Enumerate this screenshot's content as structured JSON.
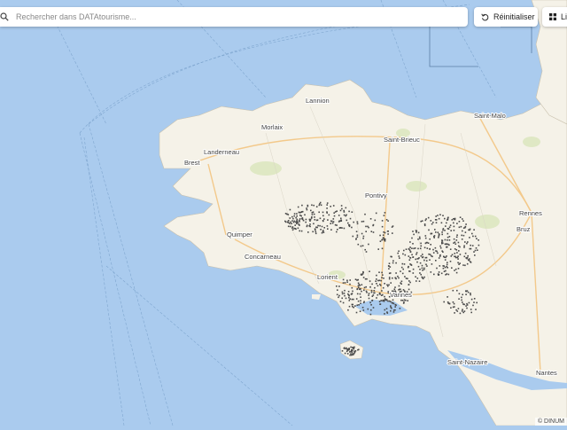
{
  "search": {
    "placeholder": "Rechercher dans DATAtourisme..."
  },
  "toolbar": {
    "reset_label": "Réinitialiser",
    "list_label": "Li"
  },
  "attribution": "© DINUM",
  "cities": [
    {
      "name": "Lannion"
    },
    {
      "name": "Morlaix"
    },
    {
      "name": "Saint-Malo"
    },
    {
      "name": "Saint-Brieuc"
    },
    {
      "name": "Landerneau"
    },
    {
      "name": "Brest"
    },
    {
      "name": "Rennes"
    },
    {
      "name": "Pontivy"
    },
    {
      "name": "Quimper"
    },
    {
      "name": "Bruz"
    },
    {
      "name": "Concarneau"
    },
    {
      "name": "Lorient"
    },
    {
      "name": "Vannes"
    },
    {
      "name": "Saint-Nazaire"
    },
    {
      "name": "Nantes"
    }
  ],
  "colors": {
    "sea": "#aacbee",
    "land": "#f5f2e8",
    "forest": "#dfe8c4",
    "road": "#f3c98b",
    "poi": "#4a4a4a"
  }
}
